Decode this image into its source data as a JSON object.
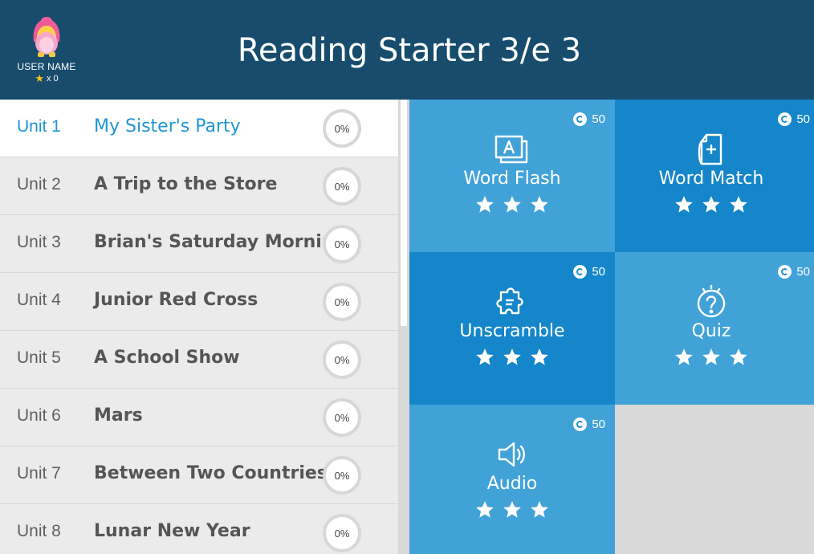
{
  "user": {
    "name": "USER NAME",
    "stars_label": "x 0"
  },
  "app_title": "Reading Starter 3/e 3",
  "units": [
    {
      "num": "Unit 1",
      "title": "My Sister's Party",
      "progress": "0%",
      "active": true
    },
    {
      "num": "Unit 2",
      "title": "A Trip to the Store",
      "progress": "0%"
    },
    {
      "num": "Unit 3",
      "title": "Brian's Saturday Morning",
      "progress": "0%"
    },
    {
      "num": "Unit 4",
      "title": "Junior Red Cross",
      "progress": "0%"
    },
    {
      "num": "Unit 5",
      "title": "A School Show",
      "progress": "0%"
    },
    {
      "num": "Unit 6",
      "title": "Mars",
      "progress": "0%"
    },
    {
      "num": "Unit 7",
      "title": "Between Two Countries",
      "progress": "0%"
    },
    {
      "num": "Unit 8",
      "title": "Lunar New Year",
      "progress": "0%"
    }
  ],
  "activities": [
    {
      "label": "Word Flash",
      "coins": "50",
      "icon": "flashcard-icon",
      "stars": 3
    },
    {
      "label": "Word Match",
      "coins": "50",
      "icon": "card-add-icon",
      "stars": 3
    },
    {
      "label": "Unscramble",
      "coins": "50",
      "icon": "puzzle-icon",
      "stars": 3
    },
    {
      "label": "Quiz",
      "coins": "50",
      "icon": "question-bulb-icon",
      "stars": 3
    },
    {
      "label": "Audio",
      "coins": "50",
      "icon": "speaker-icon",
      "stars": 3
    }
  ],
  "colors": {
    "header": "#174c6d",
    "tile_light": "#41a2d8",
    "tile_dark": "#1486c9",
    "active_unit": "#2196d3"
  }
}
